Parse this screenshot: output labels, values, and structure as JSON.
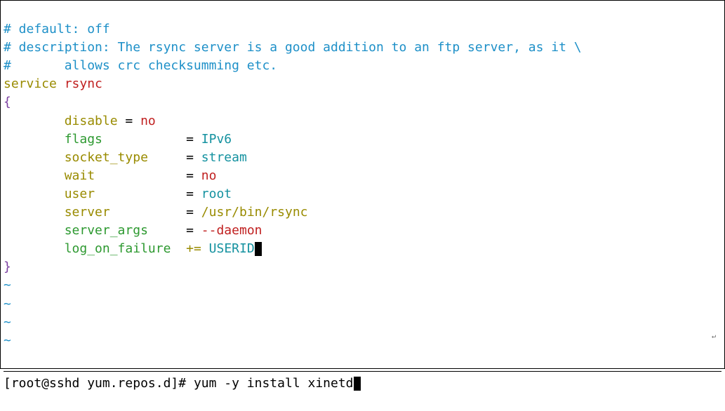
{
  "editor": {
    "comments": {
      "line1": "# default: off",
      "line2": "# description: The rsync server is a good addition to an ftp server, as it \\",
      "line3": "#       allows crc checksumming etc."
    },
    "service_keyword": "service",
    "service_name": "rsync",
    "brace_open": "{",
    "brace_close": "}",
    "params": {
      "disable": {
        "name": "disable",
        "eq": "=",
        "value": "no"
      },
      "flags": {
        "name": "flags",
        "eq": "=",
        "value": "IPv6"
      },
      "socket_type": {
        "name": "socket_type",
        "eq": "=",
        "value": "stream"
      },
      "wait": {
        "name": "wait",
        "eq": "=",
        "value": "no"
      },
      "user": {
        "name": "user",
        "eq": "=",
        "value": "root"
      },
      "server": {
        "name": "server",
        "eq": "=",
        "value": "/usr/bin/rsync"
      },
      "server_args": {
        "name": "server_args",
        "eq": "=",
        "value": "--daemon"
      },
      "log_on_failure": {
        "name": "log_on_failure",
        "eq": "+=",
        "value": "USERID"
      }
    },
    "tilde": "~"
  },
  "shell": {
    "prompt": "[root@sshd yum.repos.d]#",
    "command": "yum -y install xinetd"
  }
}
